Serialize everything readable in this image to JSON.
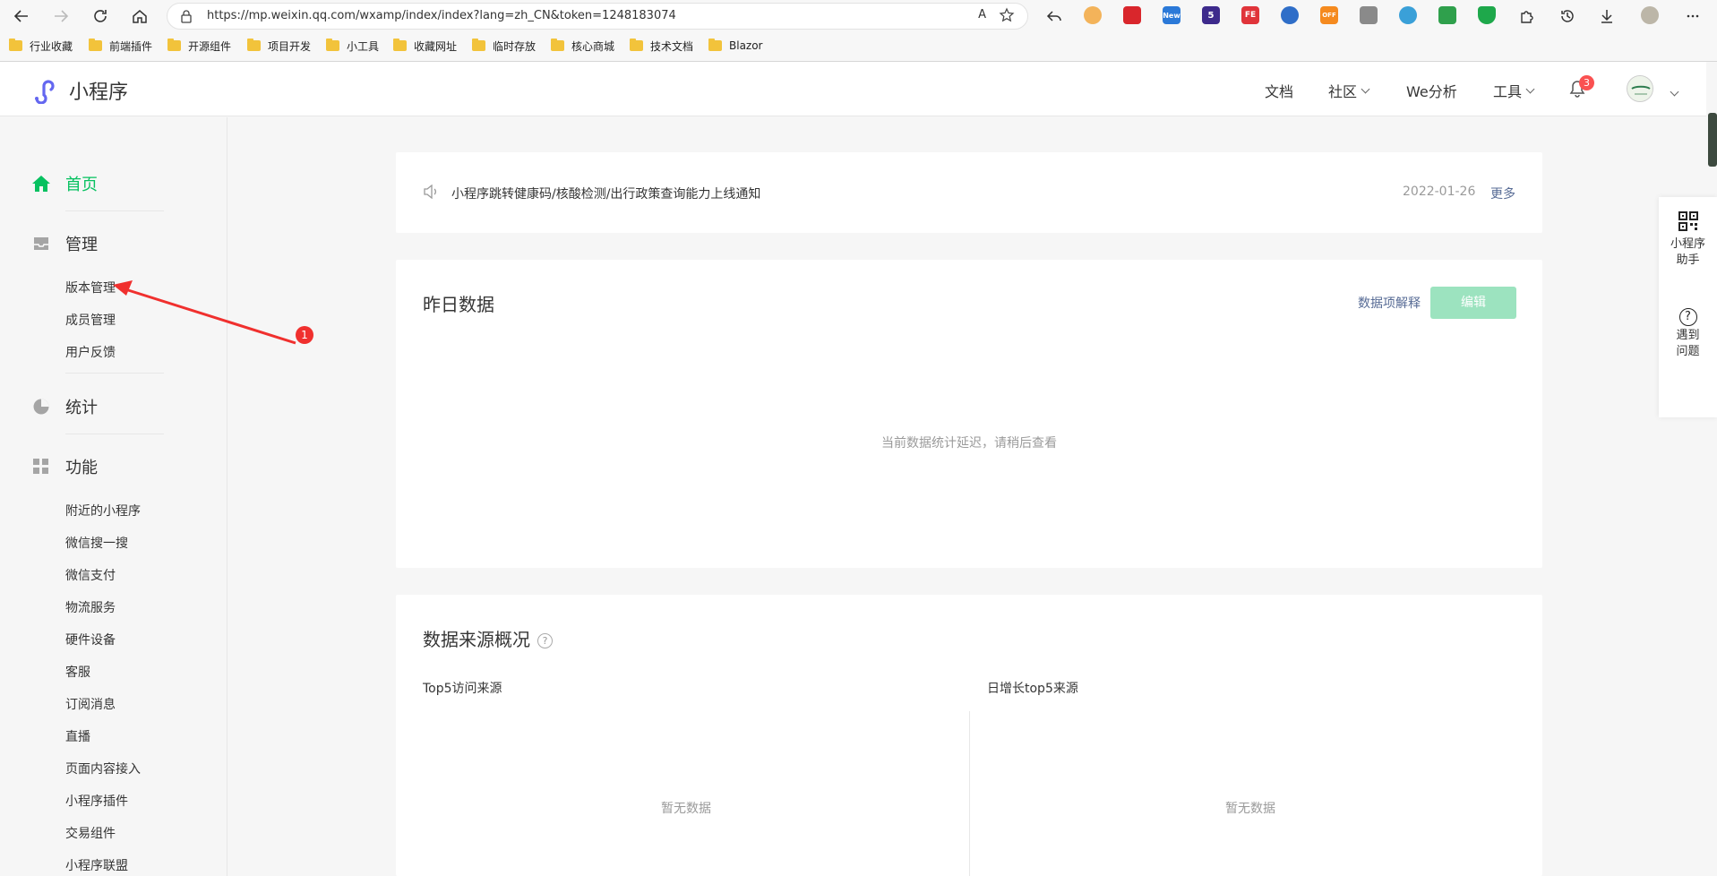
{
  "browser": {
    "url": "https://mp.weixin.qq.com/wxamp/index/index?lang=zh_CN&token=1248183074",
    "read_aloud": "A",
    "bookmarks": [
      "行业收藏",
      "前端插件",
      "开源组件",
      "项目开发",
      "小工具",
      "收藏网址",
      "临时存放",
      "核心商城",
      "技术文档",
      "Blazor"
    ],
    "ext_labels": {
      "new": "New",
      "five": "5",
      "fe": "FE",
      "off": "OFF"
    }
  },
  "header": {
    "logo_text": "小程序",
    "nav": [
      "文档",
      "社区",
      "We分析",
      "工具"
    ],
    "notification_count": "3"
  },
  "sidebar": {
    "sections": {
      "home": "首页",
      "manage": "管理",
      "stats": "统计",
      "features": "功能"
    },
    "manage_items": [
      "版本管理",
      "成员管理",
      "用户反馈"
    ],
    "feature_items": [
      "附近的小程序",
      "微信搜一搜",
      "微信支付",
      "物流服务",
      "硬件设备",
      "客服",
      "订阅消息",
      "直播",
      "页面内容接入",
      "小程序插件",
      "交易组件",
      "小程序联盟"
    ]
  },
  "notice": {
    "text": "小程序跳转健康码/核酸检测/出行政策查询能力上线通知",
    "date": "2022-01-26",
    "more": "更多"
  },
  "yesterday": {
    "title": "昨日数据",
    "explain_link": "数据项解释",
    "edit_button": "编辑",
    "empty_text": "当前数据统计延迟，请稍后查看"
  },
  "sources": {
    "title": "数据来源概况",
    "help": "?",
    "left_title": "Top5访问来源",
    "right_title": "日增长top5来源",
    "empty": "暂无数据"
  },
  "float_panel": {
    "assistant": "小程序助手",
    "assistant_l1": "小程序",
    "assistant_l2": "助手",
    "problem_l1": "遇到",
    "problem_l2": "问题",
    "help": "?"
  },
  "annotation": {
    "label": "1"
  },
  "colors": {
    "brand_green": "#07c160",
    "link": "#576b95",
    "badge_red": "#fa5151",
    "annotation_red": "#f0302e"
  }
}
